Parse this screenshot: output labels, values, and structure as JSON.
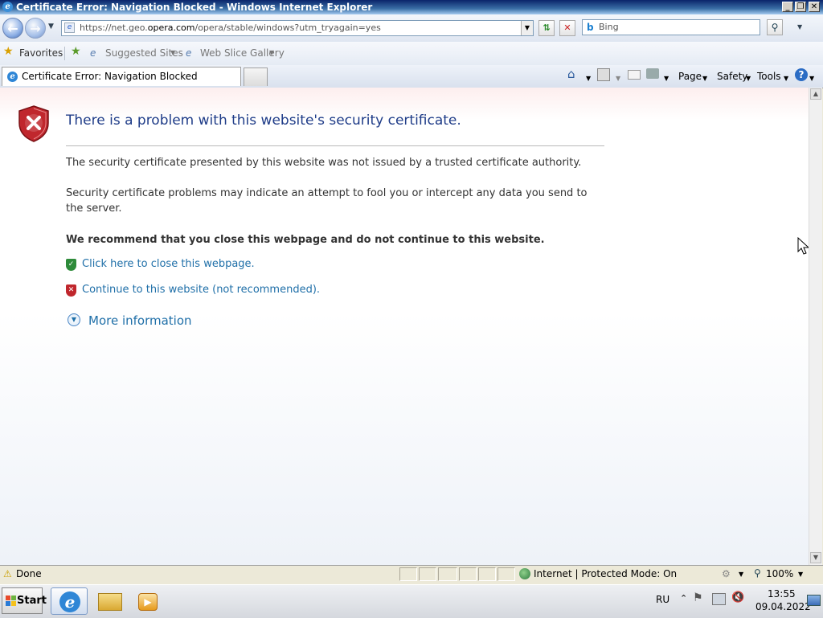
{
  "window": {
    "title": "Certificate Error: Navigation Blocked - Windows Internet Explorer",
    "minimize_glyph": "_",
    "restore_glyph": "❐",
    "close_glyph": "✕"
  },
  "address_bar": {
    "url_prefix": "https://net.geo.",
    "url_domain": "opera.com",
    "url_suffix": "/opera/stable/windows?utm_tryagain=yes"
  },
  "search": {
    "placeholder": "Bing"
  },
  "favorites_bar": {
    "favorites_label": "Favorites",
    "suggested_sites": "Suggested Sites",
    "web_slice_gallery": "Web Slice Gallery"
  },
  "tab": {
    "title": "Certificate Error: Navigation Blocked"
  },
  "command_bar": {
    "page": "Page",
    "safety": "Safety",
    "tools": "Tools",
    "help_glyph": "?"
  },
  "content": {
    "heading": "There is a problem with this website's security certificate.",
    "para1": "The security certificate presented by this website was not issued by a trusted certificate authority.",
    "para2": "Security certificate problems may indicate an attempt to fool you or intercept any data you send to the server.",
    "recommend": "We recommend that you close this webpage and do not continue to this website.",
    "close_link": "Click here to close this webpage.",
    "continue_link": "Continue to this website (not recommended).",
    "more_info": "More information"
  },
  "status_bar": {
    "status": "Done",
    "zone": "Internet | Protected Mode: On",
    "zoom": "100%"
  },
  "taskbar": {
    "start_label": "Start",
    "language": "RU",
    "time": "13:55",
    "date": "09.04.2022"
  },
  "colors": {
    "link": "#1f6fa8",
    "heading": "#1f3c88",
    "error_red": "#c0272d",
    "safe_green": "#2e8b3a"
  }
}
